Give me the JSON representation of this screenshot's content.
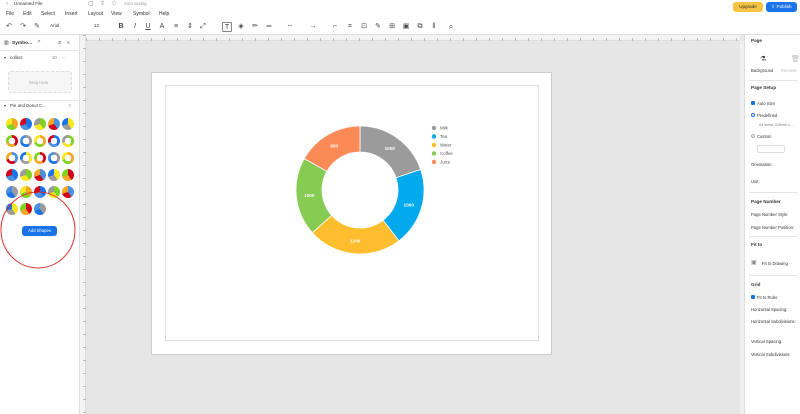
{
  "app": {
    "file_title": "Unnamed File",
    "save_status": "Auto saving",
    "upgrade_label": "Upgrade",
    "publish_label": "Publish"
  },
  "menu": [
    "File",
    "Edit",
    "Select",
    "Insert",
    "Layout",
    "View",
    "Symbol",
    "Help"
  ],
  "toolbar": {
    "font_family": "Arial",
    "font_size": "12",
    "colors": {
      "accent": "#1a73e8",
      "upgrade": "#f6c343"
    }
  },
  "left_panel": {
    "title": "Symbo...",
    "collect_label": "collect",
    "collect_count": "10",
    "drop_here": "Drag Here",
    "section_title": "Pie and Donut C...",
    "add_shapes_label": "Add Shapes"
  },
  "right_panel": {
    "tab_page": "Page",
    "background_label": "Background",
    "remove_label": "Remove",
    "page_setup": "Page Setup",
    "auto_size": "Auto Size",
    "predefined": "Predefined",
    "paper_size": "A4 sheet, 210mm x ...",
    "custom": "Custom",
    "orientation": "Orientation:",
    "unit": "Unit:",
    "page_number": "Page Number",
    "page_number_style": "Page Number Style:",
    "page_number_position": "Page Number Position:",
    "fit_to": "Fit to",
    "fit_to_drawing": "Fit to Drawing",
    "grid": "Grid",
    "fit_to_ruler": "Fit to Ruler",
    "horizontal_spacing": "Horizontal Spacing:",
    "horizontal_subdivisions": "Horizontal Subdivisions:",
    "vertical_spacing": "Vertical Spacing:",
    "vertical_subdivisions": "Vertical Subdivisions:"
  },
  "chart_data": {
    "type": "pie",
    "donut": true,
    "categories": [
      "Milk",
      "Tea",
      "Water",
      "Coffee",
      "Juice"
    ],
    "values": [
      1000,
      1000,
      1200,
      1000,
      850
    ],
    "labels": [
      "1000",
      "1000",
      "1200",
      "1000",
      "850"
    ],
    "colors": [
      "#9b9b9b",
      "#00a9ec",
      "#fdbd2c",
      "#86cb52",
      "#fc8a57"
    ],
    "legend_position": "right"
  }
}
